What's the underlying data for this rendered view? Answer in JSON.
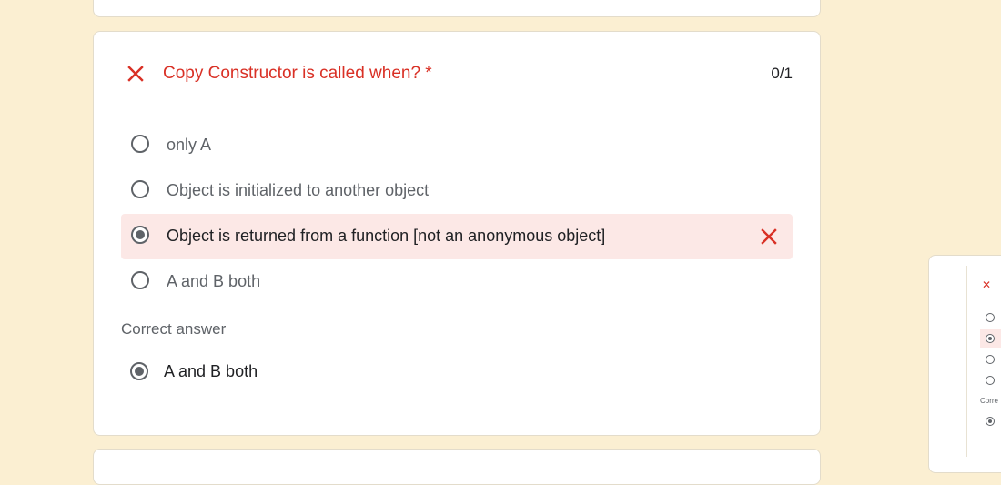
{
  "question": {
    "title": "Copy Constructor is called when? *",
    "score": "0/1",
    "status_icon": "close-icon",
    "options": [
      {
        "label": "only A",
        "selected": false,
        "incorrect": false
      },
      {
        "label": "Object is initialized to another object",
        "selected": false,
        "incorrect": false
      },
      {
        "label": "Object is returned from a function [not an anonymous object]",
        "selected": true,
        "incorrect": true
      },
      {
        "label": "A and B both",
        "selected": false,
        "incorrect": false
      }
    ],
    "correct_heading": "Correct answer",
    "correct_answer": "A and B both"
  },
  "mini_preview": {
    "correct_heading": "Corre"
  },
  "colors": {
    "page_background": "#fbefd2",
    "error": "#d93025",
    "incorrect_highlight": "#fce8e6",
    "radio": "#5f6368"
  }
}
